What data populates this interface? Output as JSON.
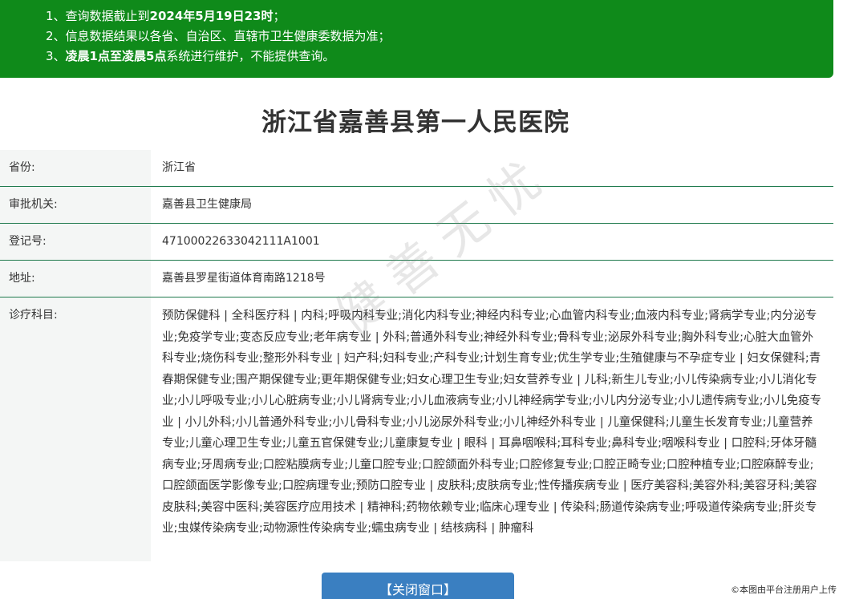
{
  "notice": {
    "line1_prefix": "1、查询数据截止到",
    "line1_bold": "2024年5月19日23时",
    "line1_suffix": "；",
    "line2": "2、信息数据结果以各省、自治区、直辖市卫生健康委数据为准；",
    "line3_prefix": "3、",
    "line3_bold": "凌晨1点至凌晨5点",
    "line3_suffix": "系统进行维护，不能提供查询。"
  },
  "hospital_name": "浙江省嘉善县第一人民医院",
  "fields": {
    "province_label": "省份:",
    "province_value": "浙江省",
    "authority_label": "审批机关:",
    "authority_value": "嘉善县卫生健康局",
    "reg_label": "登记号:",
    "reg_value": "47100022633042111A1001",
    "address_label": "地址:",
    "address_value": "嘉善县罗星街道体育南路1218号",
    "departments_label": "诊疗科目:",
    "departments_value": "预防保健科 | 全科医疗科 | 内科;呼吸内科专业;消化内科专业;神经内科专业;心血管内科专业;血液内科专业;肾病学专业;内分泌专业;免疫学专业;变态反应专业;老年病专业 | 外科;普通外科专业;神经外科专业;骨科专业;泌尿外科专业;胸外科专业;心脏大血管外科专业;烧伤科专业;整形外科专业 | 妇产科;妇科专业;产科专业;计划生育专业;优生学专业;生殖健康与不孕症专业 | 妇女保健科;青春期保健专业;围产期保健专业;更年期保健专业;妇女心理卫生专业;妇女营养专业 | 儿科;新生儿专业;小儿传染病专业;小儿消化专业;小儿呼吸专业;小儿心脏病专业;小儿肾病专业;小儿血液病专业;小儿神经病学专业;小儿内分泌专业;小儿遗传病专业;小儿免疫专业 | 小儿外科;小儿普通外科专业;小儿骨科专业;小儿泌尿外科专业;小儿神经外科专业 | 儿童保健科;儿童生长发育专业;儿童营养专业;儿童心理卫生专业;儿童五官保健专业;儿童康复专业 | 眼科 | 耳鼻咽喉科;耳科专业;鼻科专业;咽喉科专业 | 口腔科;牙体牙髓病专业;牙周病专业;口腔粘膜病专业;儿童口腔专业;口腔颌面外科专业;口腔修复专业;口腔正畸专业;口腔种植专业;口腔麻醉专业;口腔颌面医学影像专业;口腔病理专业;预防口腔专业 | 皮肤科;皮肤病专业;性传播疾病专业 | 医疗美容科;美容外科;美容牙科;美容皮肤科;美容中医科;美容医疗应用技术 | 精神科;药物依赖专业;临床心理专业 | 传染科;肠道传染病专业;呼吸道传染病专业;肝炎专业;虫媒传染病专业;动物源性传染病专业;蠕虫病专业 | 结核病科 | 肿瘤科"
  },
  "close_button": "【关闭窗口】",
  "watermark": "健善无忧",
  "corner_note": "©本图由平台注册用户上传"
}
